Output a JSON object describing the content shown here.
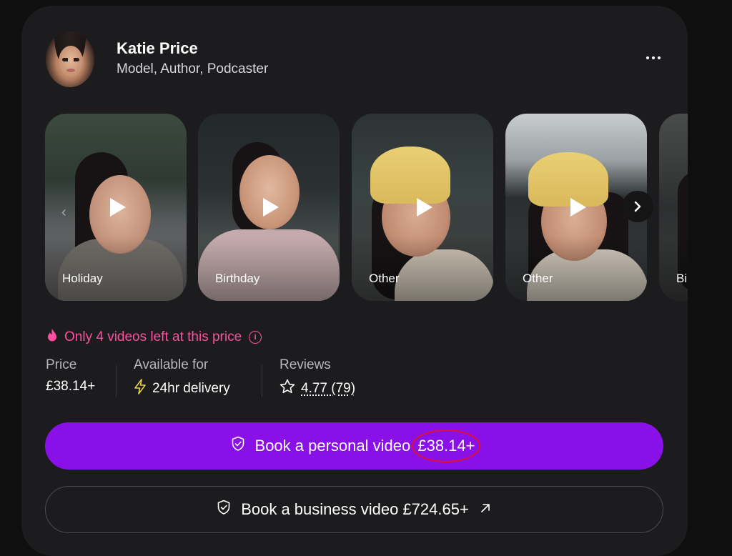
{
  "profile": {
    "name": "Katie Price",
    "subtitle": "Model, Author, Podcaster"
  },
  "videos": [
    {
      "label": "Holiday"
    },
    {
      "label": "Birthday"
    },
    {
      "label": "Other"
    },
    {
      "label": "Other"
    },
    {
      "label": "Bi"
    }
  ],
  "scarcity": {
    "text": "Only 4 videos left at this price",
    "color": "#ff4fa0"
  },
  "stats": {
    "price_label": "Price",
    "price_value": "£38.14+",
    "availability_label": "Available for",
    "availability_value": "24hr delivery",
    "reviews_label": "Reviews",
    "reviews_value": "4.77 (79)"
  },
  "actions": {
    "personal_label": "Book a personal video",
    "personal_price": "£38.14+",
    "business_label": "Book a business video £724.65+"
  },
  "colors": {
    "accent": "#8a10e8",
    "background": "#1c1c1e",
    "highlight_ring": "#e0102c",
    "lightning": "#e6d24a"
  },
  "icons": [
    "more-options-icon",
    "play-icon",
    "chevron-left-icon",
    "chevron-right-icon",
    "flame-icon",
    "info-icon",
    "lightning-icon",
    "star-icon",
    "shield-check-icon",
    "arrow-up-right-icon"
  ]
}
